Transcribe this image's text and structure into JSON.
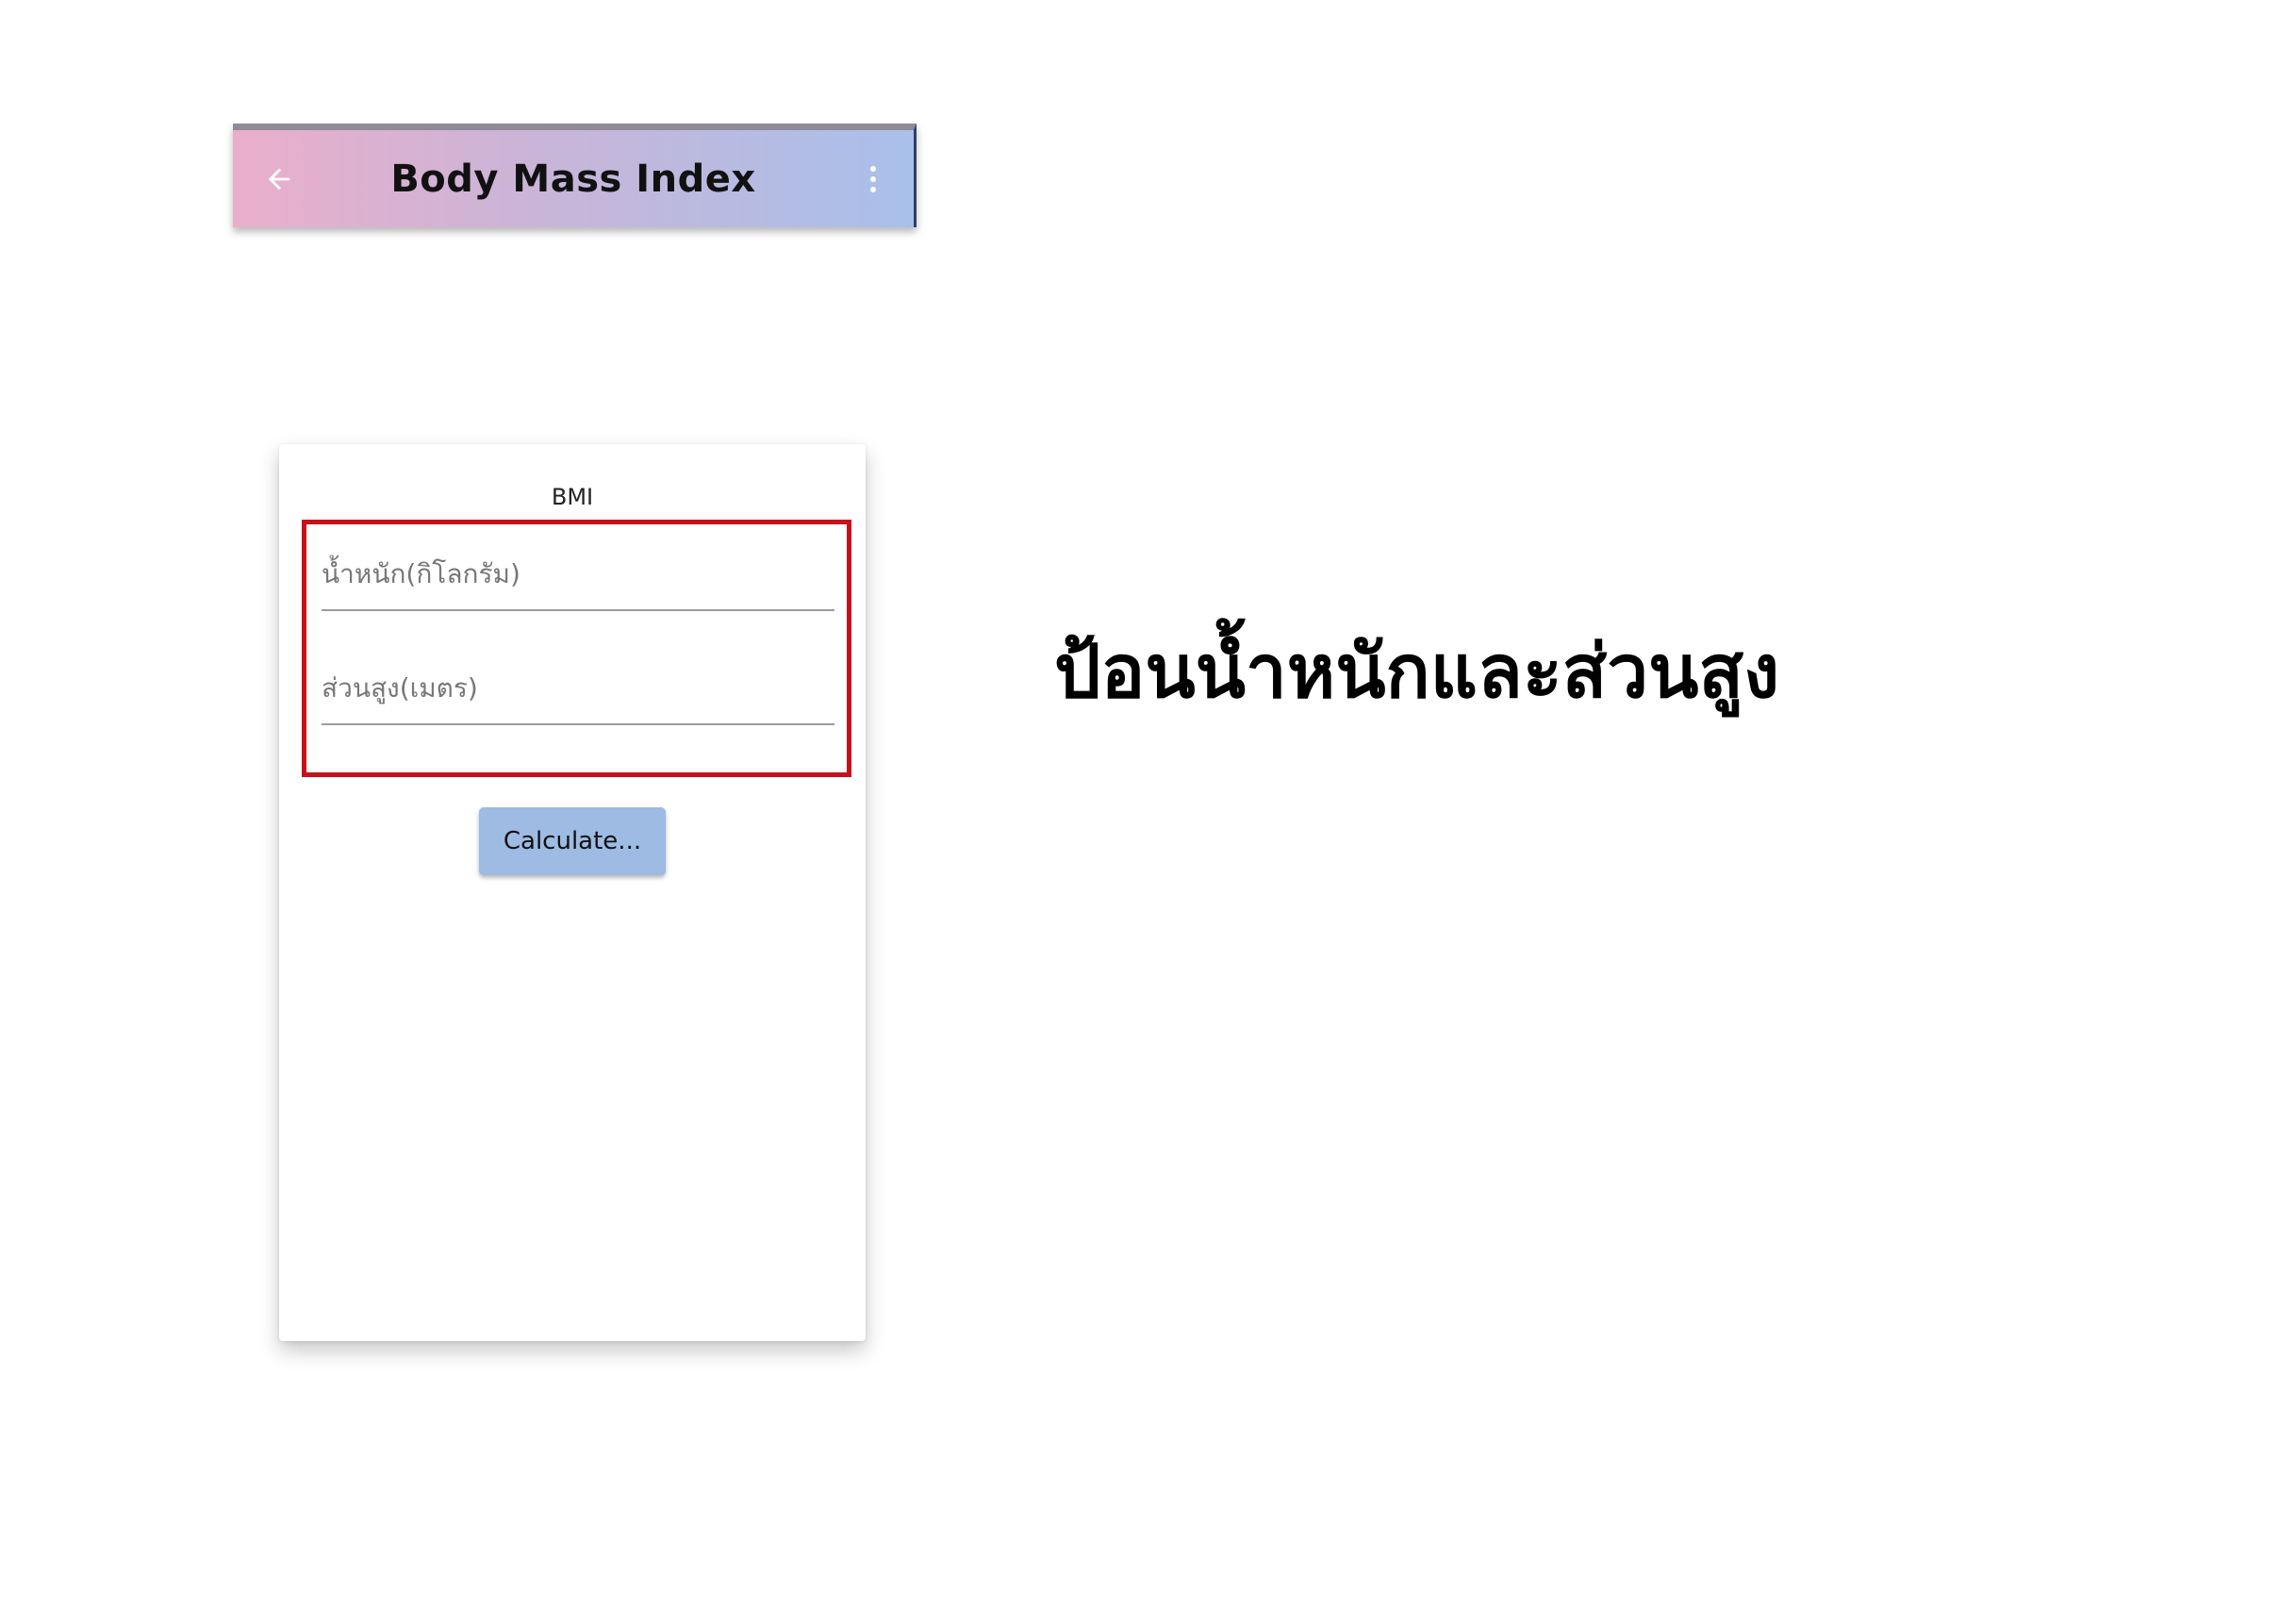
{
  "appbar": {
    "title": "Body Mass Index",
    "back_icon": "arrow-left-icon",
    "menu_icon": "more-vertical-icon"
  },
  "card": {
    "title": "BMI",
    "weight_field": {
      "placeholder": "น้ำหนัก(กิโลกรัม)",
      "value": ""
    },
    "height_field": {
      "placeholder": "ส่วนสูง(เมตร)",
      "value": ""
    },
    "calculate_label": "Calculate..."
  },
  "caption": "ป้อนน้ำหนักและส่วนสูง",
  "colors": {
    "appbar_gradient_start": "#eaaecb",
    "appbar_gradient_end": "#a8c0ea",
    "highlight_border": "#c8101b",
    "button_bg": "#9dbbe3"
  }
}
